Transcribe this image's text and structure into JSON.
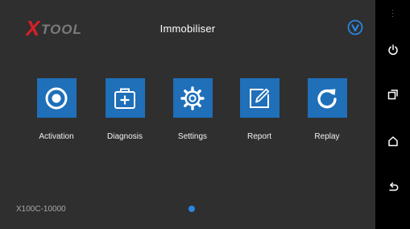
{
  "header": {
    "logo_text": "XTOOL",
    "title": "Immobiliser",
    "badge_icon": "v-badge-icon"
  },
  "apps": [
    {
      "label": "Activation",
      "icon": "radio-target-icon"
    },
    {
      "label": "Diagnosis",
      "icon": "medical-kit-icon"
    },
    {
      "label": "Settings",
      "icon": "gear-icon"
    },
    {
      "label": "Report",
      "icon": "edit-note-icon"
    },
    {
      "label": "Replay",
      "icon": "refresh-icon"
    }
  ],
  "footer": {
    "device_id": "X100C-10000",
    "page_indicator": {
      "current": 1,
      "total": 1
    }
  },
  "system_nav": [
    "menu-dots-icon",
    "power-icon",
    "recent-apps-icon",
    "home-icon",
    "back-icon"
  ],
  "colors": {
    "screen_bg": "#2f2f2f",
    "tile_blue": "#1f6fb9",
    "logo_red": "#d81f26",
    "logo_gray": "#7b7b7b",
    "accent": "#2a86e0"
  }
}
